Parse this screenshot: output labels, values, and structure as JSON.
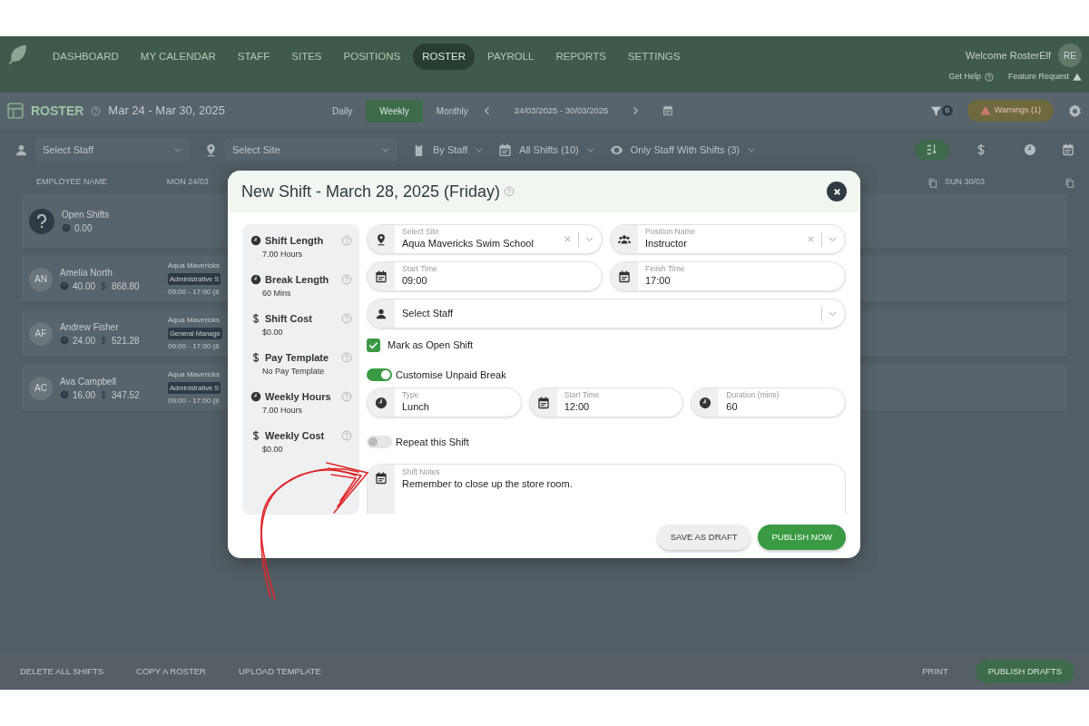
{
  "nav": {
    "items": [
      {
        "label": "DASHBOARD",
        "selected": false
      },
      {
        "label": "MY CALENDAR",
        "selected": false
      },
      {
        "label": "STAFF",
        "selected": false
      },
      {
        "label": "SITES",
        "selected": false
      },
      {
        "label": "POSITIONS",
        "selected": false
      },
      {
        "label": "ROSTER",
        "selected": true
      },
      {
        "label": "PAYROLL",
        "selected": false
      },
      {
        "label": "REPORTS",
        "selected": false
      },
      {
        "label": "SETTINGS",
        "selected": false
      }
    ],
    "welcome": "Welcome RosterElf",
    "avatar": "RE",
    "links": [
      "Get Help",
      "Feature Request"
    ]
  },
  "toolbar": {
    "title": "ROSTER",
    "date_range": "Mar 24 - Mar 30, 2025",
    "views": [
      {
        "label": "Daily",
        "selected": false
      },
      {
        "label": "Weekly",
        "selected": true
      },
      {
        "label": "Monthly",
        "selected": false
      }
    ],
    "period": "24/03/2025 - 30/03/2025",
    "filter_count": "0",
    "warnings": "Warnings (1)"
  },
  "filters": [
    {
      "kind": "select",
      "placeholder": "Select Staff"
    },
    {
      "kind": "select",
      "placeholder": "Select Site"
    },
    {
      "kind": "dropdown",
      "label": "By Staff"
    },
    {
      "kind": "dropdown",
      "label": "All Shifts (10)"
    },
    {
      "kind": "dropdown",
      "label": "Only Staff With Shifts (3)"
    }
  ],
  "view_tools": [
    {
      "kind": "sort",
      "selected": true
    },
    {
      "kind": "cost",
      "selected": false
    },
    {
      "kind": "time",
      "selected": false
    }
  ],
  "table": {
    "columns": [
      "EMPLOYEE NAME",
      "MON 24/03",
      "SUN 30/03"
    ],
    "open_shifts": {
      "name": "Open Shifts",
      "hours": "0.00"
    },
    "rows": [
      {
        "initials": "AN",
        "name": "Amelia North",
        "hours": "40.00",
        "cost": "868.80",
        "shift": {
          "site": "Aqua Mavericks",
          "position": "Administrative S",
          "time": "09:00 - 17:00 (8"
        }
      },
      {
        "initials": "AF",
        "name": "Andrew Fisher",
        "hours": "24.00",
        "cost": "521.28",
        "shift": {
          "site": "Aqua Mavericks",
          "position": "General Manage",
          "time": "09:00 - 17:00 (8"
        }
      },
      {
        "initials": "AC",
        "name": "Ava Campbell",
        "hours": "16.00",
        "cost": "347.52",
        "shift": {
          "site": "Aqua Mavericks",
          "position": "Administrative S",
          "time": "09:00 - 17:00 (8"
        }
      }
    ]
  },
  "footer": [
    {
      "kind": "left",
      "label": "DELETE ALL SHIFTS"
    },
    {
      "kind": "left",
      "label": "COPY A ROSTER"
    },
    {
      "kind": "left",
      "label": "UPLOAD TEMPLATE"
    },
    {
      "kind": "right",
      "label": "PRINT"
    },
    {
      "kind": "primary",
      "label": "PUBLISH DRAFTS"
    }
  ],
  "modal": {
    "title": "New Shift - March 28, 2025 (Friday)",
    "summary": [
      {
        "kind": "time",
        "label": "Shift Length",
        "value": "7.00 Hours"
      },
      {
        "kind": "time",
        "label": "Break Length",
        "value": "60 Mins"
      },
      {
        "kind": "money",
        "label": "Shift Cost",
        "value": "$0.00"
      },
      {
        "kind": "money",
        "label": "Pay Template",
        "value": "No Pay Template"
      },
      {
        "kind": "time",
        "label": "Weekly Hours",
        "value": "7.00 Hours"
      },
      {
        "kind": "money",
        "label": "Weekly Cost",
        "value": "$0.00"
      }
    ],
    "rows": [
      [
        {
          "kind": "location",
          "label": "Select Site",
          "value": "Aqua Mavericks Swim School",
          "clearable": true
        },
        {
          "kind": "people",
          "label": "Position Name",
          "value": "Instructor",
          "clearable": true
        }
      ],
      [
        {
          "kind": "date",
          "label": "Start Time",
          "value": "09:00"
        },
        {
          "kind": "date",
          "label": "Finish Time",
          "value": "17:00"
        }
      ],
      [
        {
          "kind": "person",
          "placeholder": "Select Staff"
        }
      ]
    ],
    "open_shift": {
      "label": "Mark as Open Shift",
      "checked": true
    },
    "unpaid_break": {
      "label": "Customise Unpaid Break",
      "on": true,
      "fields": [
        {
          "kind": "clock",
          "label": "Type",
          "value": "Lunch"
        },
        {
          "kind": "date",
          "label": "Start Time",
          "value": "12:00"
        },
        {
          "kind": "clock",
          "label": "Duration (mins)",
          "value": "60"
        }
      ]
    },
    "repeat": {
      "label": "Repeat this Shift",
      "on": false
    },
    "notes": {
      "label": "Shift Notes",
      "value": "Remember to close up the store room."
    },
    "buttons": [
      {
        "kind": "secondary",
        "label": "SAVE AS DRAFT"
      },
      {
        "kind": "primary",
        "label": "PUBLISH NOW"
      }
    ]
  }
}
